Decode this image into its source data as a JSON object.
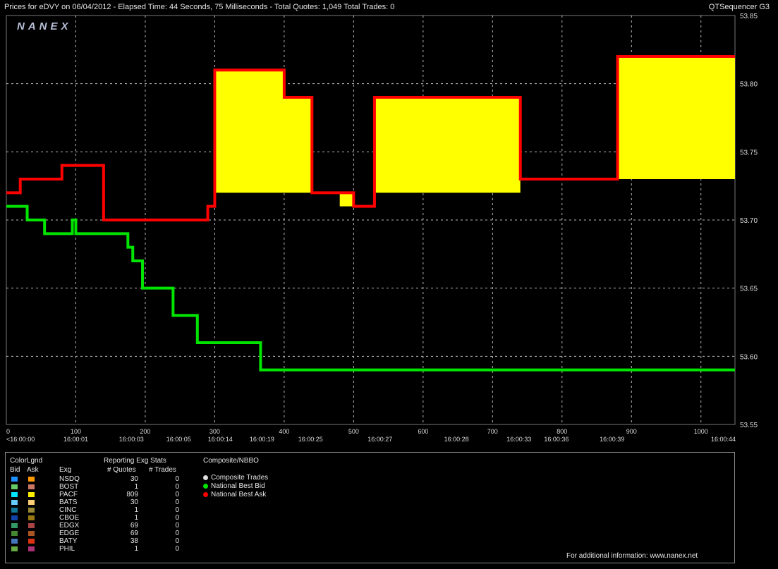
{
  "header": {
    "title": "Prices for  eDVY  on  06/04/2012  -  Elapsed Time: 44 Seconds, 75 Milliseconds  -  Total Quotes: 1,049  Total Trades: 0",
    "app_name": "QTSequencer G3"
  },
  "chart_data": {
    "type": "line",
    "logo": "NANEX",
    "ylim": [
      53.55,
      53.85
    ],
    "y_ticks": [
      "53.85",
      "53.80",
      "53.75",
      "53.70",
      "53.65",
      "53.60",
      "53.55"
    ],
    "xlim": [
      0,
      1049
    ],
    "x_ticks": [
      "0",
      "100",
      "200",
      "300",
      "400",
      "500",
      "600",
      "700",
      "800",
      "900",
      "1000"
    ],
    "x_tick_values": [
      0,
      100,
      200,
      300,
      400,
      500,
      600,
      700,
      800,
      900,
      1000
    ],
    "time_labels": [
      "<16:00:00",
      "16:00:01",
      "16:00:03",
      "16:00:05",
      "16:00:14",
      "16:00:19",
      "16:00:25",
      "16:00:27",
      "16:00:28",
      "16:00:33",
      "16:00:36",
      "16:00:39",
      "16:00:44"
    ],
    "time_label_x": [
      0,
      100,
      180,
      248,
      308,
      368,
      438,
      538,
      648,
      738,
      792,
      872,
      1050
    ],
    "nbbo": {
      "bid": [
        [
          0,
          53.71
        ],
        [
          30,
          53.7
        ],
        [
          55,
          53.69
        ],
        [
          95,
          53.7
        ],
        [
          100,
          53.69
        ],
        [
          130,
          53.69
        ],
        [
          140,
          53.69
        ],
        [
          175,
          53.68
        ],
        [
          182,
          53.67
        ],
        [
          196,
          53.65
        ],
        [
          240,
          53.63
        ],
        [
          275,
          53.61
        ],
        [
          366,
          53.59
        ],
        [
          1049,
          53.59
        ]
      ],
      "ask": [
        [
          0,
          53.72
        ],
        [
          20,
          53.73
        ],
        [
          80,
          53.74
        ],
        [
          140,
          53.7
        ],
        [
          290,
          53.71
        ],
        [
          300,
          53.81
        ],
        [
          400,
          53.79
        ],
        [
          440,
          53.72
        ],
        [
          500,
          53.71
        ],
        [
          530,
          53.79
        ],
        [
          650,
          53.79
        ],
        [
          665,
          53.79
        ],
        [
          740,
          53.73
        ],
        [
          880,
          53.82
        ],
        [
          1049,
          53.82
        ]
      ]
    },
    "spread_fill_color": "#ffff00",
    "bid_color": "#00e400",
    "ask_color": "#ff0000"
  },
  "legend": {
    "color_title": "ColorLgnd",
    "bid_header": "Bid",
    "ask_header": "Ask",
    "exg_header": "Exg",
    "stats_title": "Reporting Exg Stats",
    "quotes_header": "# Quotes",
    "trades_header": "# Trades",
    "rows": [
      {
        "exg": "NSDQ",
        "quotes": "30",
        "trades": "0",
        "bid_color": "#1e90ff",
        "ask_color": "#ff9900"
      },
      {
        "exg": "BOST",
        "quotes": "1",
        "trades": "0",
        "bid_color": "#66cc66",
        "ask_color": "#cc7766"
      },
      {
        "exg": "PACF",
        "quotes": "809",
        "trades": "0",
        "bid_color": "#00e5ff",
        "ask_color": "#ffee00"
      },
      {
        "exg": "BATS",
        "quotes": "30",
        "trades": "0",
        "bid_color": "#66ccff",
        "ask_color": "#ffcc77"
      },
      {
        "exg": "CINC",
        "quotes": "1",
        "trades": "0",
        "bid_color": "#117799",
        "ask_color": "#998833"
      },
      {
        "exg": "CBOE",
        "quotes": "1",
        "trades": "0",
        "bid_color": "#1144aa",
        "ask_color": "#997711"
      },
      {
        "exg": "EDGX",
        "quotes": "69",
        "trades": "0",
        "bid_color": "#339966",
        "ask_color": "#aa4444"
      },
      {
        "exg": "EDGE",
        "quotes": "69",
        "trades": "0",
        "bid_color": "#448833",
        "ask_color": "#aa5522"
      },
      {
        "exg": "BATY",
        "quotes": "38",
        "trades": "0",
        "bid_color": "#4477bb",
        "ask_color": "#dd3311"
      },
      {
        "exg": "PHIL",
        "quotes": "1",
        "trades": "0",
        "bid_color": "#66aa44",
        "ask_color": "#aa3377"
      }
    ],
    "composite_title": "Composite/NBBO",
    "composite_items": [
      {
        "label": "Composite Trades",
        "color": "#dddddd"
      },
      {
        "label": "National Best Bid",
        "color": "#00e400"
      },
      {
        "label": "National Best Ask",
        "color": "#ff0000"
      }
    ],
    "footer": "For additional information: www.nanex.net"
  }
}
